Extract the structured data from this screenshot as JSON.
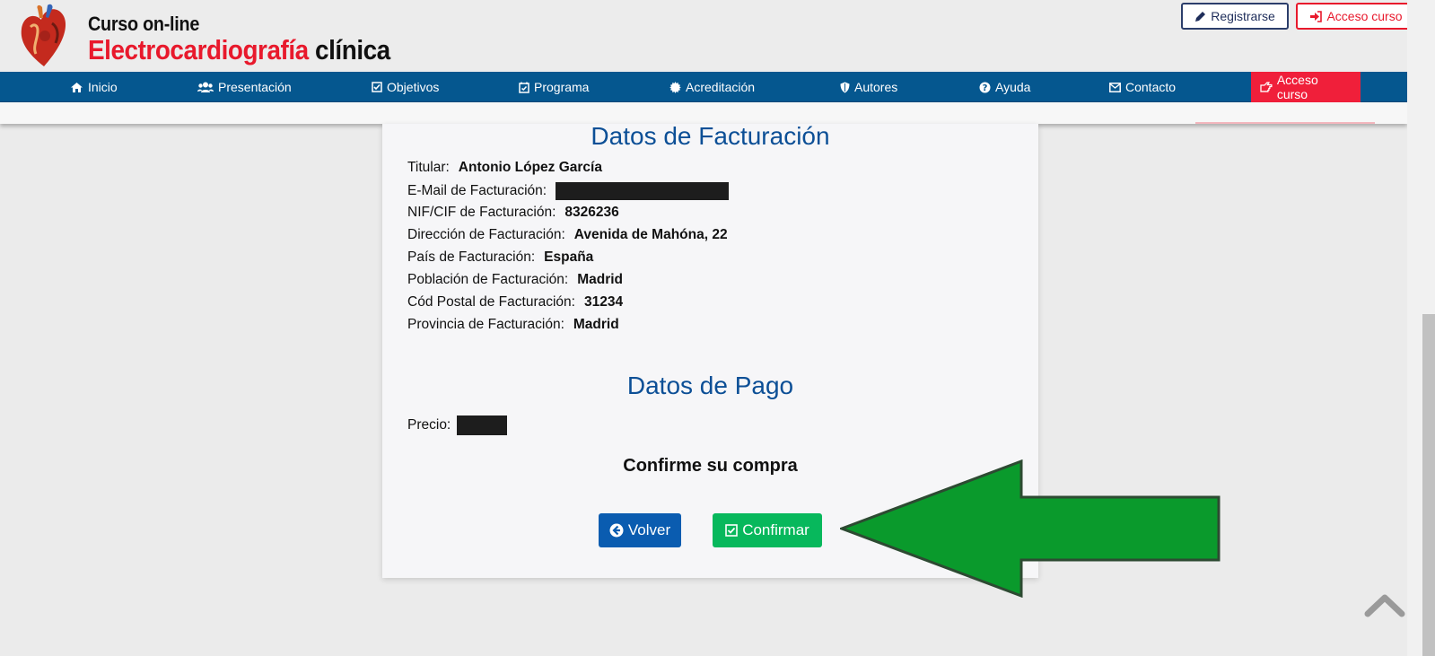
{
  "header": {
    "brand_line1": "Curso on-line",
    "brand_line2_red": "Electrocardiografía",
    "brand_line2_black": "clínica",
    "register_label": "Registrarse",
    "access_label": "Acceso curso"
  },
  "nav": {
    "items": [
      {
        "label": "Inicio",
        "icon": "home-icon"
      },
      {
        "label": "Presentación",
        "icon": "users-icon"
      },
      {
        "label": "Objetivos",
        "icon": "checkbox-icon"
      },
      {
        "label": "Programa",
        "icon": "calendar-check-icon"
      },
      {
        "label": "Acreditación",
        "icon": "certificate-icon"
      },
      {
        "label": "Autores",
        "icon": "shield-icon"
      },
      {
        "label": "Ayuda",
        "icon": "question-icon"
      },
      {
        "label": "Contacto",
        "icon": "envelope-icon"
      },
      {
        "label": "Acceso curso",
        "icon": "hand-point-right-icon",
        "active": true
      }
    ]
  },
  "billing": {
    "title": "Datos de Facturación",
    "fields": [
      {
        "label": "Titular:",
        "value": "Antonio López García"
      },
      {
        "label": "E-Mail de Facturación:",
        "value": ""
      },
      {
        "label": "NIF/CIF de Facturación:",
        "value": "8326236"
      },
      {
        "label": "Dirección de Facturación:",
        "value": "Avenida de Mahóna, 22"
      },
      {
        "label": "País de Facturación:",
        "value": "España"
      },
      {
        "label": "Población de Facturación:",
        "value": "Madrid"
      },
      {
        "label": "Cód Postal de Facturación:",
        "value": "31234"
      },
      {
        "label": "Provincia de Facturación:",
        "value": "Madrid"
      }
    ]
  },
  "payment": {
    "title": "Datos de Pago",
    "price_label": "Precio:",
    "confirm_prompt": "Confirme su compra",
    "back_label": "Volver",
    "confirm_label": "Confirmar"
  },
  "colors": {
    "nav_bg": "#05578f",
    "accent_red": "#e8192c",
    "title_blue": "#0c4f96",
    "back_blue": "#0a5cb0",
    "confirm_green": "#07b85c",
    "arrow_green": "#0a9a2c"
  }
}
